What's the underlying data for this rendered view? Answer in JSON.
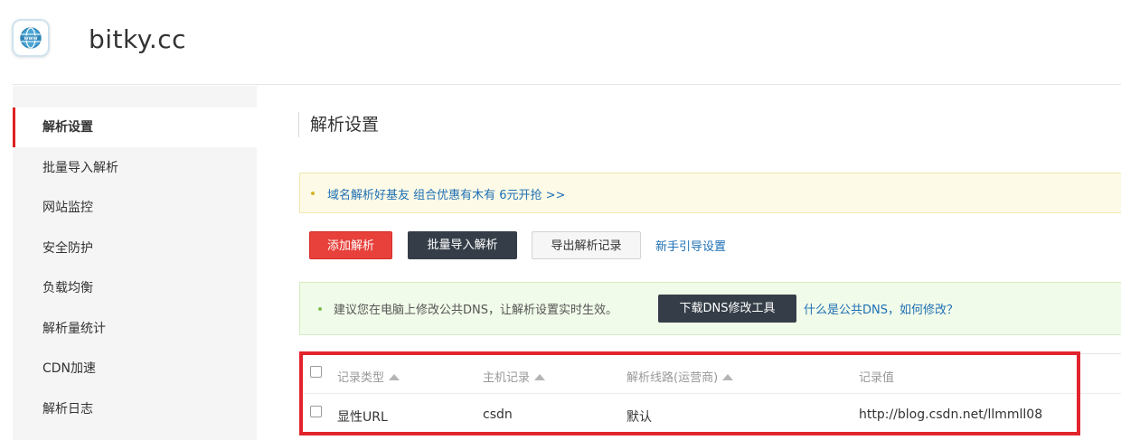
{
  "header": {
    "domain": "bitky.cc",
    "logo_icon": "www-globe-icon"
  },
  "sidebar": {
    "items": [
      {
        "label": "解析设置",
        "active": true
      },
      {
        "label": "批量导入解析"
      },
      {
        "label": "网站监控"
      },
      {
        "label": "安全防护"
      },
      {
        "label": "负载均衡"
      },
      {
        "label": "解析量统计"
      },
      {
        "label": "CDN加速"
      },
      {
        "label": "解析日志"
      }
    ]
  },
  "main": {
    "title": "解析设置",
    "promo": "域名解析好基友 组合优惠有木有 6元开抢 >>",
    "actions": {
      "add": "添加解析",
      "batch_import": "批量导入解析",
      "export": "导出解析记录",
      "guide": "新手引导设置"
    },
    "dns_tip": {
      "text": "建议您在电脑上修改公共DNS，让解析设置实时生效。",
      "button": "下载DNS修改工具",
      "link": "什么是公共DNS，如何修改？"
    },
    "table": {
      "headers": [
        "记录类型",
        "主机记录",
        "解析线路(运营商)",
        "记录值"
      ],
      "rows": [
        {
          "type": "显性URL",
          "host": "csdn",
          "line": "默认",
          "value": "http://blog.csdn.net/llmmll08"
        }
      ]
    }
  },
  "colors": {
    "accent_red": "#e8403a",
    "dark_button": "#353e48",
    "link_blue": "#1e6fb5",
    "highlight_box": "#e2242c"
  }
}
